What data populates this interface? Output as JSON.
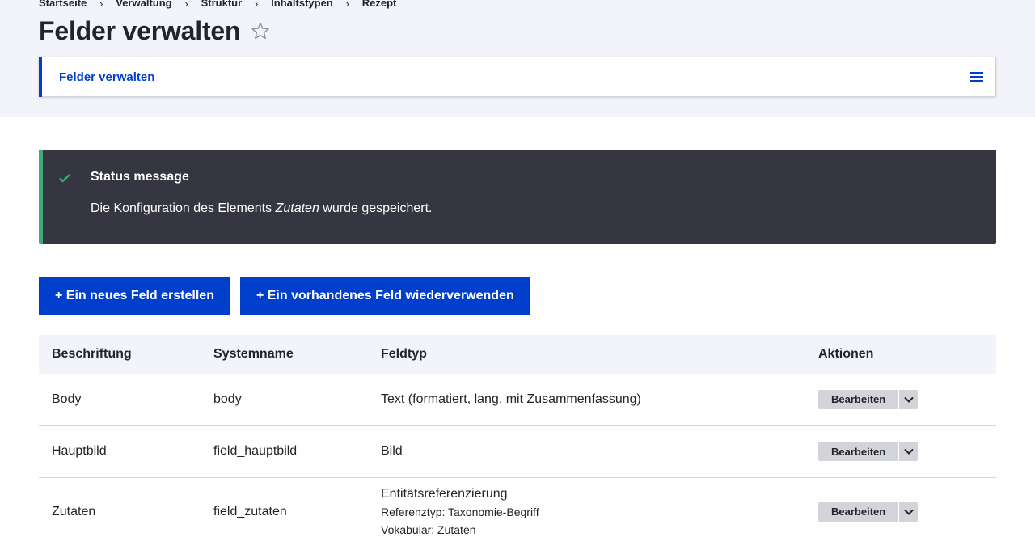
{
  "breadcrumb": [
    "Startseite",
    "Verwaltung",
    "Struktur",
    "Inhaltstypen",
    "Rezept"
  ],
  "page_title": "Felder verwalten",
  "tabs": {
    "active_label": "Felder verwalten"
  },
  "status": {
    "title": "Status message",
    "text_before": "Die Konfiguration des Elements ",
    "text_emphasis": "Zutaten",
    "text_after": " wurde gespeichert."
  },
  "actions": {
    "add_field": "+ Ein neues Feld erstellen",
    "reuse_field": "+ Ein vorhandenes Feld wiederverwenden"
  },
  "table": {
    "headers": [
      "Beschriftung",
      "Systemname",
      "Feldtyp",
      "Aktionen"
    ],
    "rows": [
      {
        "label": "Body",
        "machine_name": "body",
        "type": "Text (formatiert, lang, mit Zusammenfassung)",
        "details": [],
        "edit_label": "Bearbeiten"
      },
      {
        "label": "Hauptbild",
        "machine_name": "field_hauptbild",
        "type": "Bild",
        "details": [],
        "edit_label": "Bearbeiten"
      },
      {
        "label": "Zutaten",
        "machine_name": "field_zutaten",
        "type": "Entitätsreferenzierung",
        "details": [
          "Referenztyp: Taxonomie-Begriff",
          "Vokabular: Zutaten"
        ],
        "edit_label": "Bearbeiten"
      }
    ]
  },
  "colors": {
    "accent": "#003ecc",
    "status_bg": "#353641",
    "status_stripe": "#42a877",
    "header_bg": "#f3f4f9"
  },
  "icons": {
    "favorite": "star-outline-icon",
    "tabs_toggle": "hamburger-menu-icon",
    "status": "checkmark-icon",
    "dropdown": "chevron-down-icon"
  }
}
